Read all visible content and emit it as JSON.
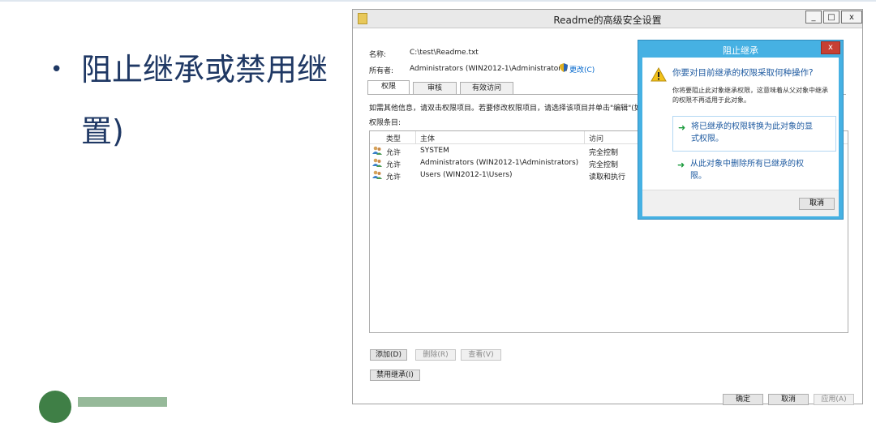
{
  "slide": {
    "bullet": "•",
    "line1": "阻止继承或禁用继",
    "line2": "置)"
  },
  "window": {
    "title": "Readme的高级安全设置",
    "buttons": {
      "min": "_",
      "max": "□",
      "close": "x"
    },
    "name_label": "名称:",
    "name_value": "C:\\test\\Readme.txt",
    "owner_label": "所有者:",
    "owner_value": "Administrators (WIN2012-1\\Administrators)",
    "change_link": "更改(C)",
    "tabs": [
      "权限",
      "审核",
      "有效访问"
    ],
    "hint": "如需其他信息，请双击权限项目。若要修改权限项目，请选择该项目并单击\"编辑\"(如",
    "entries_label": "权限条目:",
    "columns": [
      "类型",
      "主体",
      "访问"
    ],
    "rows": [
      {
        "type": "允许",
        "principal": "SYSTEM",
        "access": "完全控制"
      },
      {
        "type": "允许",
        "principal": "Administrators (WIN2012-1\\Administrators)",
        "access": "完全控制"
      },
      {
        "type": "允许",
        "principal": "Users (WIN2012-1\\Users)",
        "access": "读取和执行"
      }
    ],
    "add_button": "添加(D)",
    "remove_button": "删除(R)",
    "view_button": "查看(V)",
    "disable_inheritance_button": "禁用继承(I)",
    "ok_button": "确定",
    "cancel_button": "取消",
    "apply_button": "应用(A)"
  },
  "dialog": {
    "title": "阻止继承",
    "close": "x",
    "question": "你要对目前继承的权限采取何种操作?",
    "desc_line1": "你将要阻止此对象继承权限，这意味着从父对象中继承",
    "desc_line2": "的权限不再适用于此对象。",
    "option1_line1": "将已继承的权限转换为此对象的显",
    "option1_line2": "式权限。",
    "option2_line1": "从此对象中删除所有已继承的权",
    "option2_line2": "限。",
    "cancel_button": "取消"
  },
  "colors": {
    "slide_text": "#1f3864",
    "dialog_frame": "#46b1e3",
    "dialog_close": "#c74033",
    "link_blue": "#1e5aa0",
    "arrow_green": "#1a9b3c"
  }
}
